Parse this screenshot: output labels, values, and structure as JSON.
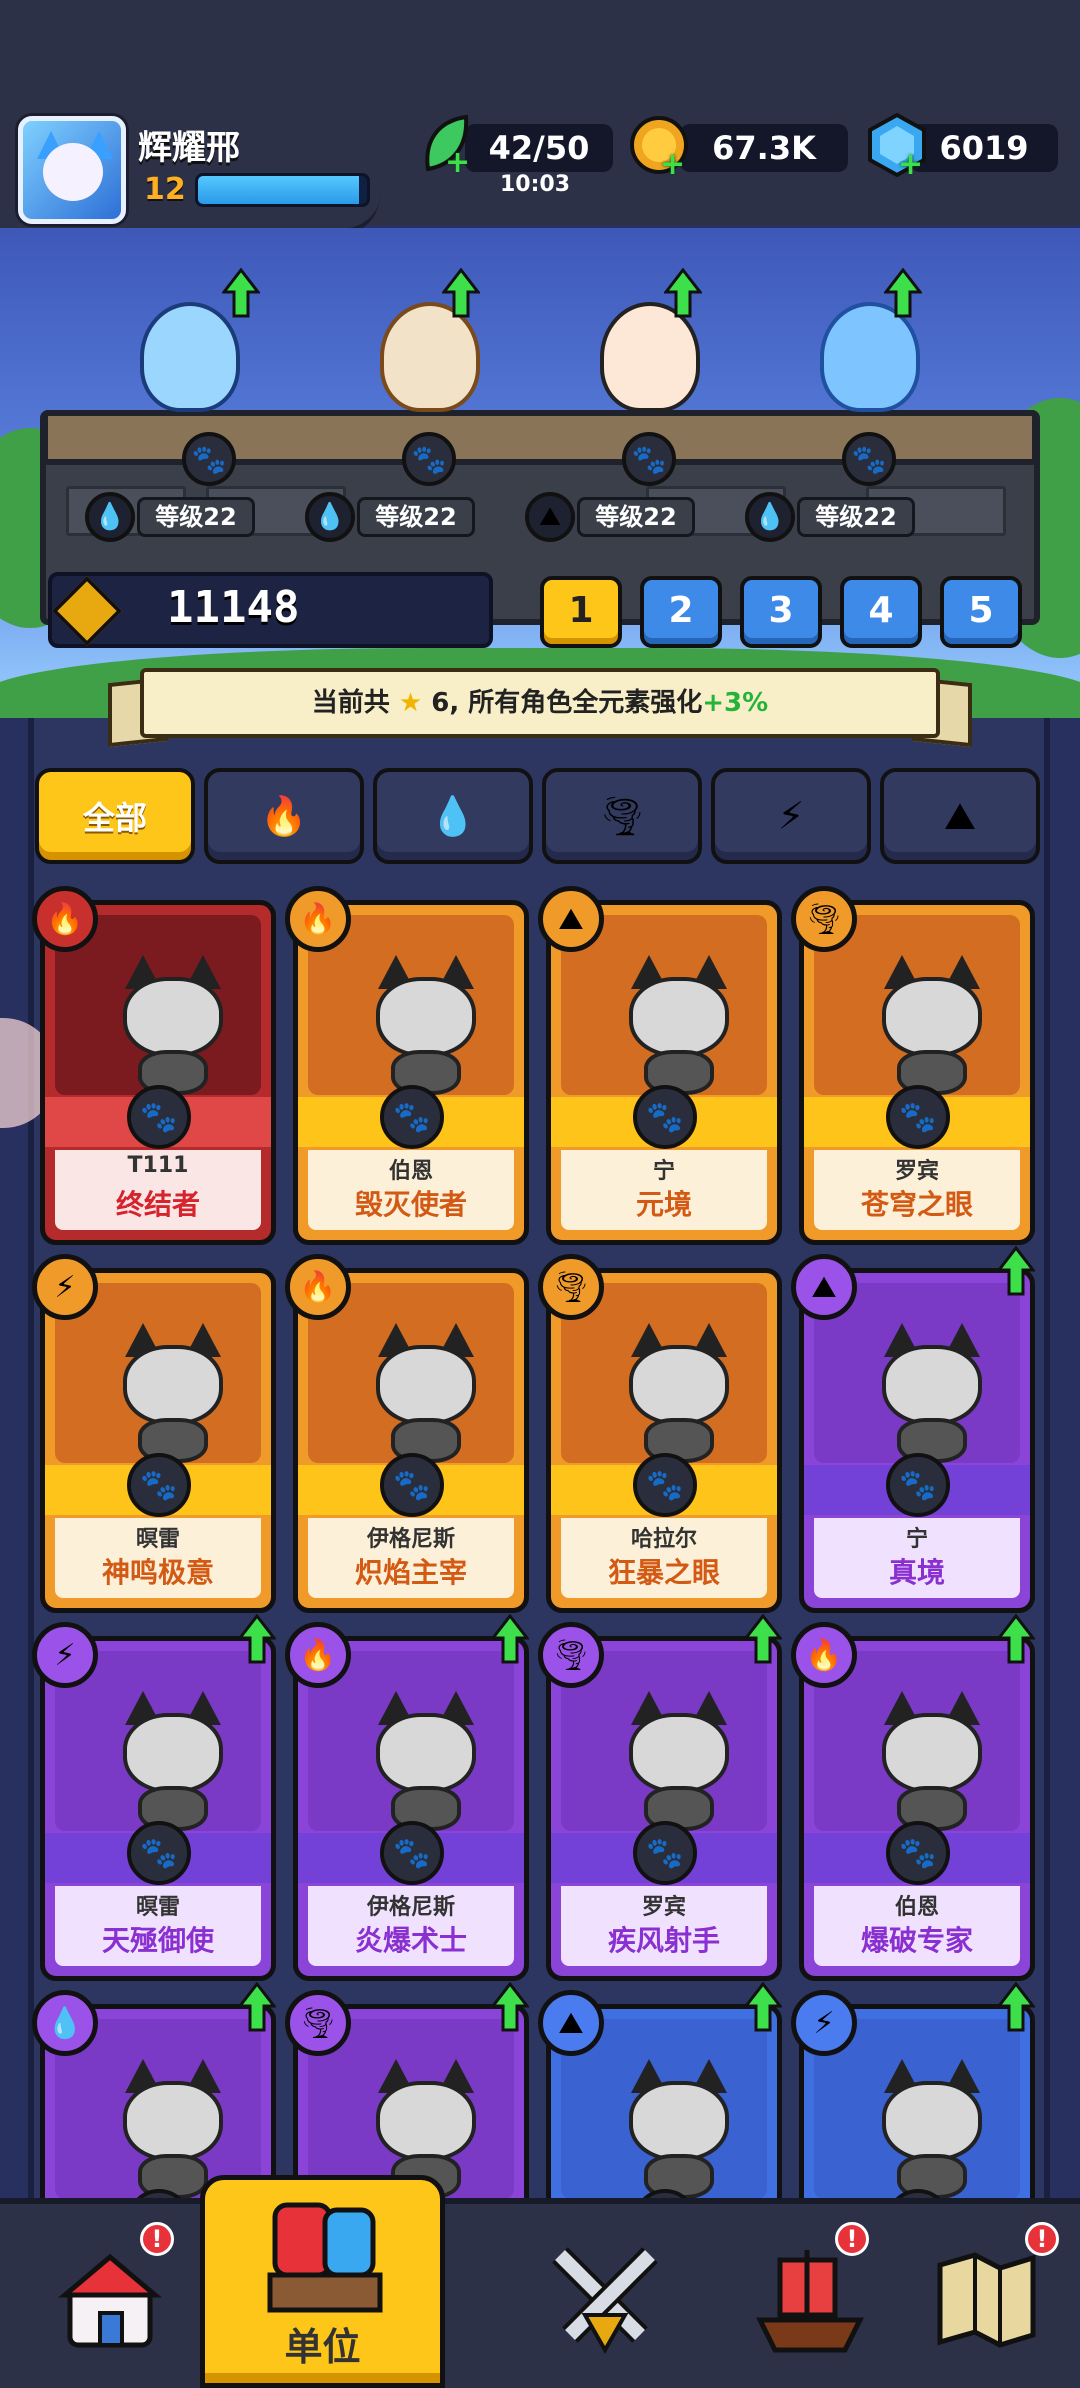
{
  "player": {
    "name": "辉耀邢",
    "level": "12",
    "xp_fraction": 0.95
  },
  "resources": {
    "stamina": "42/50",
    "stamina_timer": "10:03",
    "coins": "67.3K",
    "gems": "6019"
  },
  "team": [
    {
      "level_label": "等级22",
      "element": "water",
      "element_icon": "💧"
    },
    {
      "level_label": "等级22",
      "element": "water",
      "element_icon": "💧"
    },
    {
      "level_label": "等级22",
      "element": "earth",
      "element_icon": "⛰"
    },
    {
      "level_label": "等级22",
      "element": "water",
      "element_icon": "💧"
    }
  ],
  "power": "11148",
  "slots": [
    "1",
    "2",
    "3",
    "4",
    "5"
  ],
  "active_slot": "1",
  "banner": {
    "prefix": "当前共",
    "star": "★",
    "count_text": "6, 所有角色全元素强化",
    "bonus": "+3%"
  },
  "filters": {
    "all_label": "全部",
    "icons": [
      "🔥",
      "💧",
      "🌪",
      "⚡",
      "⛰"
    ]
  },
  "cards": [
    {
      "sub": "T111",
      "name": "终结者",
      "rarity": "red",
      "element": "🔥",
      "upgrade": false
    },
    {
      "sub": "伯恩",
      "name": "毁灭使者",
      "rarity": "orange",
      "element": "🔥",
      "upgrade": false
    },
    {
      "sub": "宁",
      "name": "元境",
      "rarity": "orange",
      "element": "⛰",
      "upgrade": false
    },
    {
      "sub": "罗宾",
      "name": "苍穹之眼",
      "rarity": "orange",
      "element": "🌪",
      "upgrade": false
    },
    {
      "sub": "暝雷",
      "name": "神鸣极意",
      "rarity": "orange",
      "element": "⚡",
      "upgrade": false
    },
    {
      "sub": "伊格尼斯",
      "name": "炽焰主宰",
      "rarity": "orange",
      "element": "🔥",
      "upgrade": false
    },
    {
      "sub": "哈拉尔",
      "name": "狂暴之眼",
      "rarity": "orange",
      "element": "🌪",
      "upgrade": false
    },
    {
      "sub": "宁",
      "name": "真境",
      "rarity": "purple",
      "element": "⛰",
      "upgrade": true
    },
    {
      "sub": "暝雷",
      "name": "天殛御使",
      "rarity": "purple",
      "element": "⚡",
      "upgrade": true
    },
    {
      "sub": "伊格尼斯",
      "name": "炎爆术士",
      "rarity": "purple",
      "element": "🔥",
      "upgrade": true
    },
    {
      "sub": "罗宾",
      "name": "疾风射手",
      "rarity": "purple",
      "element": "🌪",
      "upgrade": true
    },
    {
      "sub": "伯恩",
      "name": "爆破专家",
      "rarity": "purple",
      "element": "🔥",
      "upgrade": true
    },
    {
      "sub": "",
      "name": "",
      "rarity": "purple",
      "element": "💧",
      "upgrade": true
    },
    {
      "sub": "",
      "name": "",
      "rarity": "purple",
      "element": "🌪",
      "upgrade": true
    },
    {
      "sub": "",
      "name": "",
      "rarity": "blue",
      "element": "⛰",
      "upgrade": true
    },
    {
      "sub": "",
      "name": "",
      "rarity": "blue",
      "element": "⚡",
      "upgrade": true
    }
  ],
  "nav": {
    "units_label": "单位",
    "notification_mark": "!"
  },
  "colors": {
    "accent_yellow": "#ffc61a",
    "upgrade_green": "#3de04a",
    "bg_dark": "#2c3148"
  }
}
